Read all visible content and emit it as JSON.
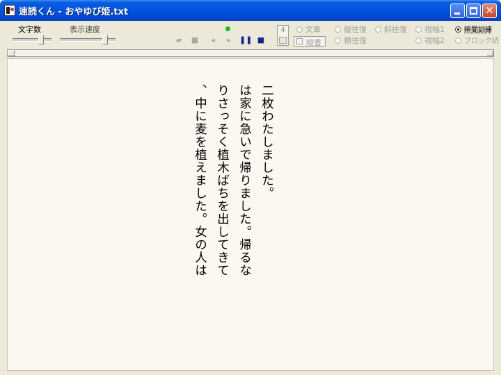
{
  "window": {
    "title": "速読くん - おやゆび姫.txt",
    "app_icon": "sokudoku-app-icon"
  },
  "toolbar": {
    "char_count_label": "文字数",
    "display_speed_label": "表示速度",
    "page_number": "4",
    "tategaki_label": "縦書",
    "icons": [
      "open-folder-icon",
      "save-icon",
      "prev-icon",
      "next-icon",
      "pause-icon",
      "stop-icon"
    ],
    "status_color": "#1dbb1d",
    "radios": [
      {
        "label": "文章",
        "selected": false
      },
      {
        "label": "縦往復",
        "selected": false
      },
      {
        "label": "斜往復",
        "selected": false
      },
      {
        "label": "視幅1",
        "selected": false
      },
      {
        "label": "瞬間訓練",
        "selected": true
      },
      {
        "label": "横往復",
        "selected": false
      },
      {
        "label": "視幅2",
        "selected": false
      },
      {
        "label": "ブロック読",
        "selected": false
      }
    ]
  },
  "reader": {
    "columns": [
      "二枚わたしました。",
      "は家に急いで帰りました。帰るな",
      "りさっそく植木ばちを出してきて",
      "、中に麦を植えました。女の人は"
    ]
  }
}
